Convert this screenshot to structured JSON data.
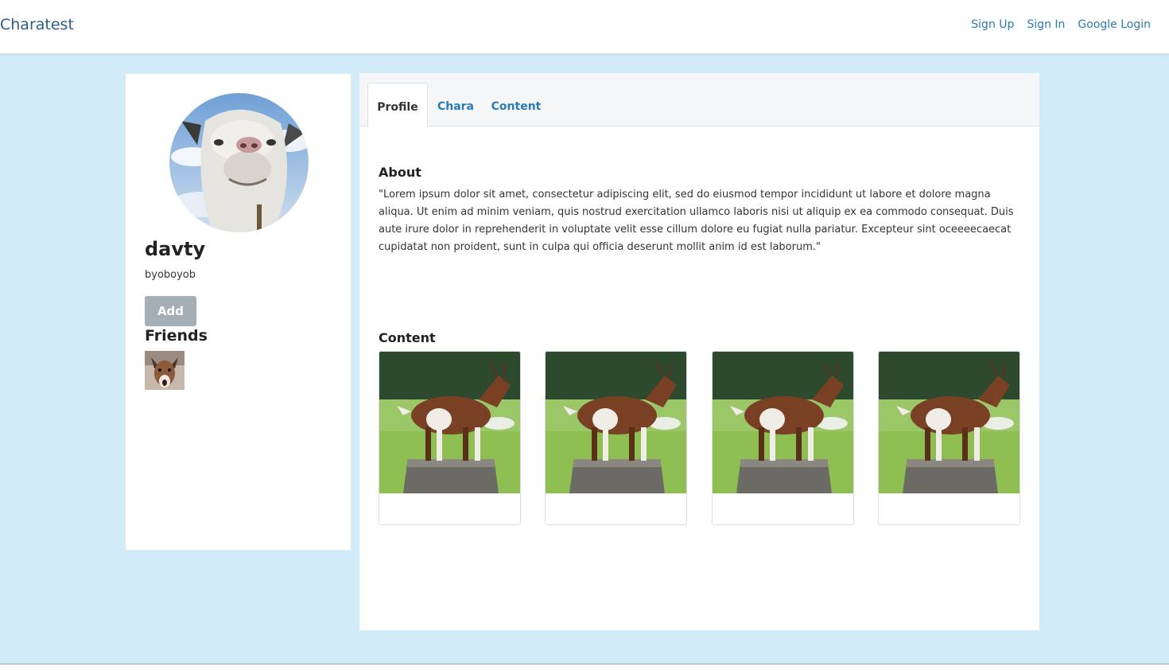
{
  "navbar": {
    "brand": "Charatest",
    "links": [
      "Sign Up",
      "Sign In",
      "Google Login"
    ]
  },
  "profile": {
    "display_name": "davty",
    "handle": "byoboyob",
    "add_label": "Add",
    "friends_title": "Friends",
    "avatar_icon": "goat-face-avatar",
    "friend_icon": "goat-friend-thumbnail"
  },
  "tabs": [
    {
      "label": "Profile",
      "active": true
    },
    {
      "label": "Chara",
      "active": false
    },
    {
      "label": "Content",
      "active": false
    }
  ],
  "about": {
    "title": "About",
    "text": "\"Lorem ipsum dolor sit amet, consectetur adipiscing elit, sed do eiusmod tempor incididunt ut labore et dolore magna aliqua. Ut enim ad minim veniam, quis nostrud exercitation ullamco laboris nisi ut aliquip ex ea commodo consequat. Duis aute irure dolor in reprehenderit in voluptate velit esse cillum dolore eu fugiat nulla pariatur. Excepteur sint oceeeecaecat cupidatat non proident, sunt in culpa qui officia deserunt mollit anim id est laborum.\""
  },
  "content": {
    "title": "Content",
    "items": [
      {
        "image": "goat-on-stump"
      },
      {
        "image": "goat-on-stump"
      },
      {
        "image": "goat-on-stump"
      },
      {
        "image": "goat-on-stump"
      }
    ]
  },
  "colors": {
    "background": "#d2ebf8",
    "link": "#2b7ab8",
    "brand": "#2a5d8a",
    "button": "#a5adb5"
  }
}
